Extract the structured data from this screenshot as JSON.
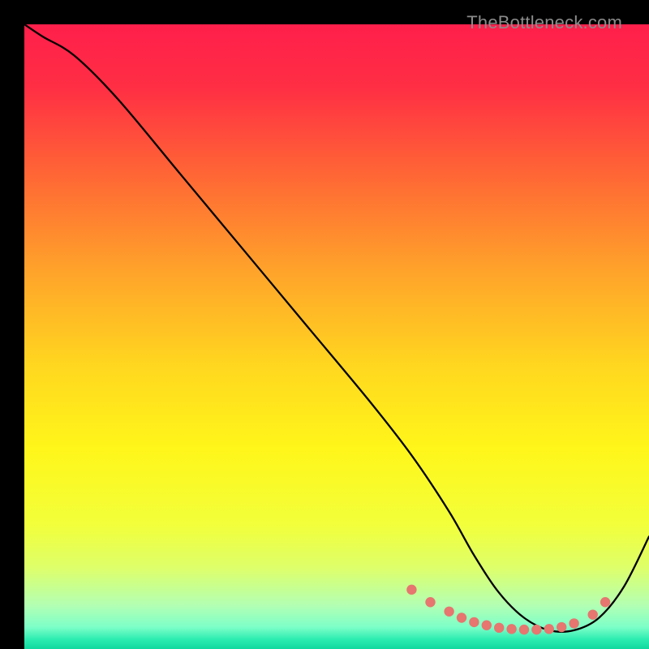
{
  "watermark": "TheBottleneck.com",
  "chart_data": {
    "type": "line",
    "title": "",
    "xlabel": "",
    "ylabel": "",
    "xlim": [
      0,
      100
    ],
    "ylim": [
      0,
      100
    ],
    "grid": false,
    "series": [
      {
        "name": "bottleneck-curve",
        "x": [
          0,
          3,
          8,
          15,
          25,
          35,
          45,
          55,
          62,
          68,
          72,
          76,
          80,
          84,
          88,
          92,
          96,
          100
        ],
        "y": [
          100,
          98,
          95,
          88,
          76,
          64,
          52,
          40,
          31,
          22,
          15,
          9,
          5,
          3,
          3,
          5,
          10,
          18
        ]
      }
    ],
    "highlight_points": {
      "name": "dotted-valley",
      "x": [
        62,
        65,
        68,
        70,
        72,
        74,
        76,
        78,
        80,
        82,
        84,
        86,
        88,
        91,
        93
      ],
      "y": [
        9.5,
        7.5,
        6,
        5,
        4.3,
        3.8,
        3.4,
        3.2,
        3.1,
        3.1,
        3.2,
        3.5,
        4.1,
        5.5,
        7.5
      ]
    },
    "background_gradient": {
      "type": "vertical",
      "stops": [
        {
          "offset": 0.0,
          "color": "#ff1f4b"
        },
        {
          "offset": 0.1,
          "color": "#ff2e44"
        },
        {
          "offset": 0.25,
          "color": "#ff6a34"
        },
        {
          "offset": 0.4,
          "color": "#ffa52a"
        },
        {
          "offset": 0.55,
          "color": "#ffd81f"
        },
        {
          "offset": 0.68,
          "color": "#fff61a"
        },
        {
          "offset": 0.8,
          "color": "#f2ff3a"
        },
        {
          "offset": 0.87,
          "color": "#deff6a"
        },
        {
          "offset": 0.93,
          "color": "#b3ffb3"
        },
        {
          "offset": 0.965,
          "color": "#7dffc8"
        },
        {
          "offset": 0.985,
          "color": "#2becb0"
        },
        {
          "offset": 1.0,
          "color": "#10d89f"
        }
      ]
    },
    "dot_color": "#e6766f",
    "curve_color": "#000000"
  }
}
